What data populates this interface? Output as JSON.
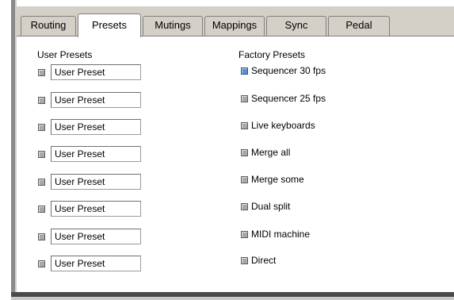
{
  "tabs": [
    {
      "label": "Routing",
      "active": false
    },
    {
      "label": "Presets",
      "active": true
    },
    {
      "label": "Mutings",
      "active": false
    },
    {
      "label": "Mappings",
      "active": false
    },
    {
      "label": "Sync",
      "active": false
    },
    {
      "label": "Pedal",
      "active": false
    }
  ],
  "user_presets": {
    "heading": "User Presets",
    "items": [
      {
        "value": "User Preset",
        "checked": false
      },
      {
        "value": "User Preset",
        "checked": false
      },
      {
        "value": "User Preset",
        "checked": false
      },
      {
        "value": "User Preset",
        "checked": false
      },
      {
        "value": "User Preset",
        "checked": false
      },
      {
        "value": "User Preset",
        "checked": false
      },
      {
        "value": "User Preset",
        "checked": false
      },
      {
        "value": "User Preset",
        "checked": false
      }
    ]
  },
  "factory_presets": {
    "heading": "Factory Presets",
    "items": [
      {
        "label": "Sequencer 30 fps",
        "checked": true
      },
      {
        "label": "Sequencer 25 fps",
        "checked": false
      },
      {
        "label": "Live keyboards",
        "checked": false
      },
      {
        "label": "Merge all",
        "checked": false
      },
      {
        "label": "Merge some",
        "checked": false
      },
      {
        "label": "Dual split",
        "checked": false
      },
      {
        "label": "MIDI machine",
        "checked": false
      },
      {
        "label": "Direct",
        "checked": false
      }
    ]
  },
  "colors": {
    "panel_background": "#d4d0c8",
    "checked_indicator": "#5b8fd0",
    "unchecked_indicator": "#a8a8a8"
  }
}
